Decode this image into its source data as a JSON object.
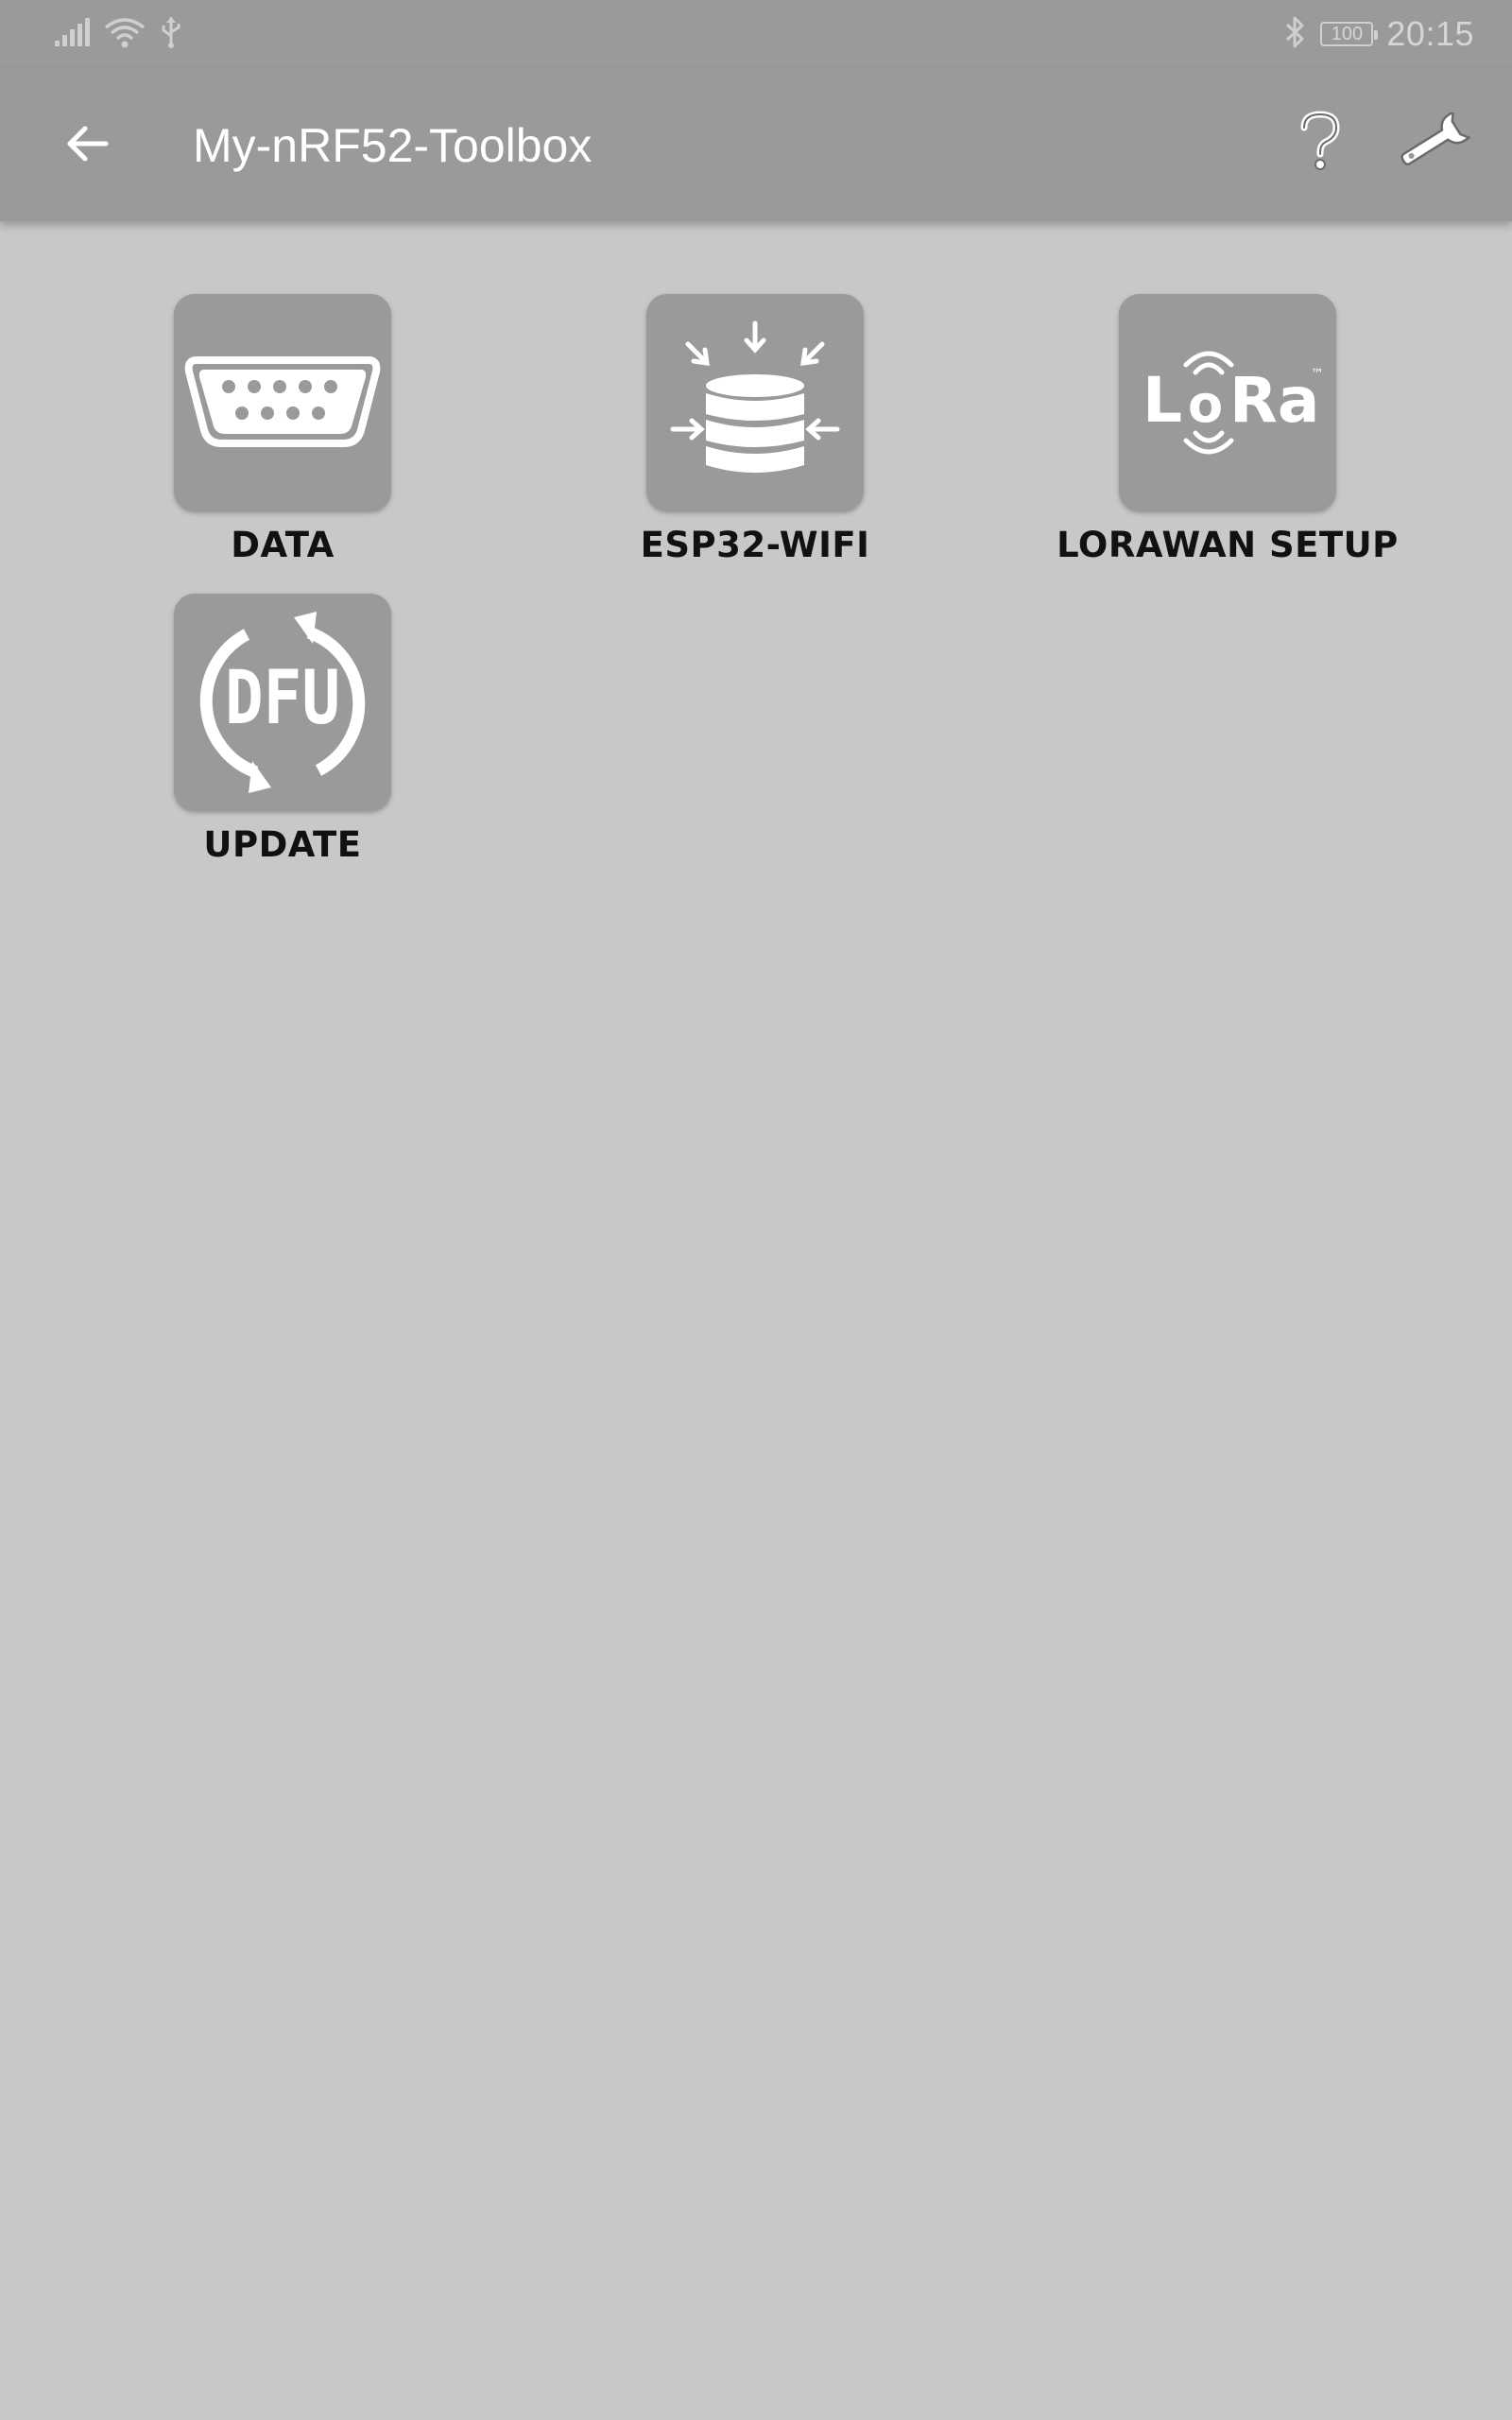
{
  "status_bar": {
    "time": "20:15",
    "battery": "100",
    "icons": [
      "signal-icon",
      "wifi-icon",
      "usb-icon",
      "bluetooth-icon",
      "battery-icon"
    ]
  },
  "app_bar": {
    "title": "My-nRF52-Toolbox",
    "back_icon": "arrow-back-icon",
    "help_icon": "help-icon",
    "settings_icon": "wrench-icon"
  },
  "tiles": [
    {
      "label": "DATA",
      "icon": "serial-connector-icon"
    },
    {
      "label": "ESP32-WIFI",
      "icon": "database-icon"
    },
    {
      "label": "LORAWAN SETUP",
      "icon": "lora-logo-icon"
    },
    {
      "label": "UPDATE",
      "icon": "dfu-icon"
    }
  ],
  "lora_logo": {
    "text_l": "L",
    "text_o": "o",
    "text_ra": "Ra",
    "tm": "™"
  },
  "dfu_logo": {
    "text": "DFU"
  },
  "colors": {
    "bars": "#9a9a9a",
    "background": "#c8c8c8",
    "tile": "#9a9a9a",
    "label": "#111111",
    "title": "#ffffff"
  }
}
